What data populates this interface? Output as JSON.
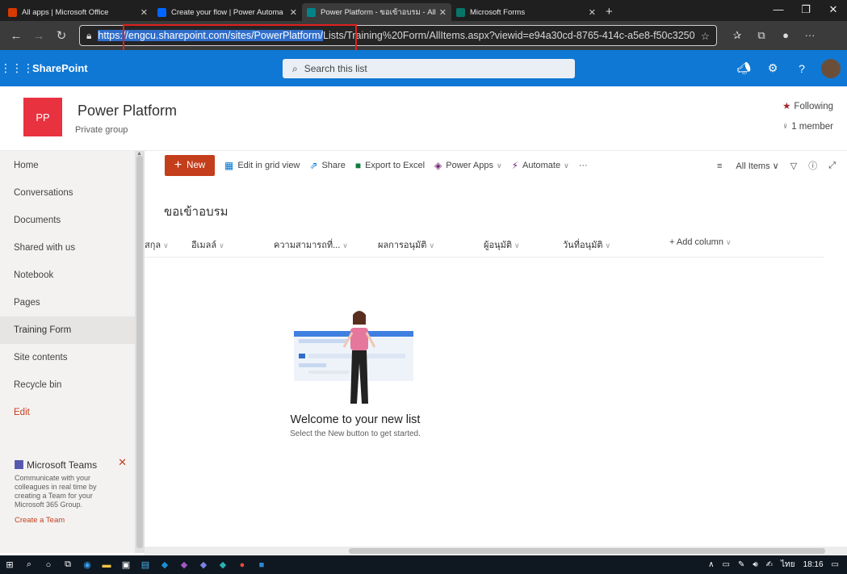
{
  "browser": {
    "tabs": [
      {
        "title": "All apps | Microsoft Office",
        "color": "#d83b01"
      },
      {
        "title": "Create your flow | Power Automa",
        "color": "#0066ff"
      },
      {
        "title": "Power Platform - ขอเข้าอบรม - All",
        "color": "#038387",
        "active": true
      },
      {
        "title": "Microsoft Forms",
        "color": "#077568"
      }
    ],
    "url_selected": "https://engcu.sharepoint.com/sites/PowerPlatform/",
    "url_rest": "Lists/Training%20Form/AllItems.aspx?viewid=e94a30cd-8765-414c-a5e8-f50c3250"
  },
  "suite": {
    "brand": "SharePoint",
    "search_placeholder": "Search this list"
  },
  "site": {
    "logo": "PP",
    "title": "Power Platform",
    "subtitle": "Private group",
    "following": "Following",
    "members": "1 member"
  },
  "nav": {
    "items": [
      "Home",
      "Conversations",
      "Documents",
      "Shared with us",
      "Notebook",
      "Pages",
      "Training Form",
      "Site contents",
      "Recycle bin",
      "Edit"
    ],
    "active": "Training Form"
  },
  "teams_card": {
    "title": "Microsoft Teams",
    "desc": "Communicate with your colleagues in real time by creating a Team for your Microsoft 365 Group.",
    "link": "Create a Team"
  },
  "commands": {
    "new": "New",
    "edit_grid": "Edit in grid view",
    "share": "Share",
    "export": "Export to Excel",
    "power_apps": "Power Apps",
    "automate": "Automate",
    "more": "···",
    "view": "All Items"
  },
  "list": {
    "title": "ขอเข้าอบรม",
    "columns": [
      "สกุล",
      "อีเมลล์",
      "ความสามารถที่...",
      "ผลการอนุมัติ",
      "ผู้อนุมัติ",
      "วันที่อนุมัติ"
    ],
    "add_column": "+ Add column",
    "empty_title": "Welcome to your new list",
    "empty_sub": "Select the New button to get started."
  },
  "taskbar": {
    "lang": "ไทย",
    "time": "18:16"
  }
}
